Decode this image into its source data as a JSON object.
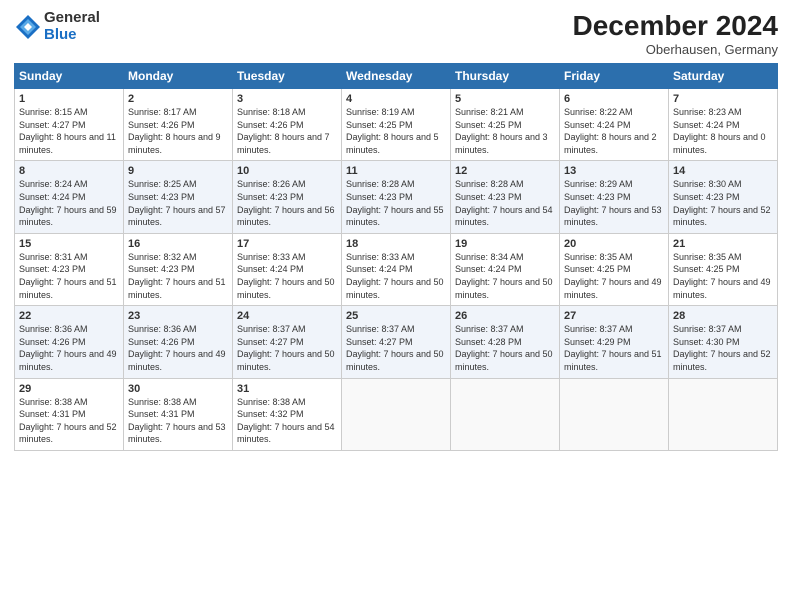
{
  "logo": {
    "general": "General",
    "blue": "Blue"
  },
  "title": "December 2024",
  "subtitle": "Oberhausen, Germany",
  "weekdays": [
    "Sunday",
    "Monday",
    "Tuesday",
    "Wednesday",
    "Thursday",
    "Friday",
    "Saturday"
  ],
  "weeks": [
    [
      {
        "day": "1",
        "sunrise": "8:15 AM",
        "sunset": "4:27 PM",
        "daylight": "8 hours and 11 minutes."
      },
      {
        "day": "2",
        "sunrise": "8:17 AM",
        "sunset": "4:26 PM",
        "daylight": "8 hours and 9 minutes."
      },
      {
        "day": "3",
        "sunrise": "8:18 AM",
        "sunset": "4:26 PM",
        "daylight": "8 hours and 7 minutes."
      },
      {
        "day": "4",
        "sunrise": "8:19 AM",
        "sunset": "4:25 PM",
        "daylight": "8 hours and 5 minutes."
      },
      {
        "day": "5",
        "sunrise": "8:21 AM",
        "sunset": "4:25 PM",
        "daylight": "8 hours and 3 minutes."
      },
      {
        "day": "6",
        "sunrise": "8:22 AM",
        "sunset": "4:24 PM",
        "daylight": "8 hours and 2 minutes."
      },
      {
        "day": "7",
        "sunrise": "8:23 AM",
        "sunset": "4:24 PM",
        "daylight": "8 hours and 0 minutes."
      }
    ],
    [
      {
        "day": "8",
        "sunrise": "8:24 AM",
        "sunset": "4:24 PM",
        "daylight": "7 hours and 59 minutes."
      },
      {
        "day": "9",
        "sunrise": "8:25 AM",
        "sunset": "4:23 PM",
        "daylight": "7 hours and 57 minutes."
      },
      {
        "day": "10",
        "sunrise": "8:26 AM",
        "sunset": "4:23 PM",
        "daylight": "7 hours and 56 minutes."
      },
      {
        "day": "11",
        "sunrise": "8:28 AM",
        "sunset": "4:23 PM",
        "daylight": "7 hours and 55 minutes."
      },
      {
        "day": "12",
        "sunrise": "8:28 AM",
        "sunset": "4:23 PM",
        "daylight": "7 hours and 54 minutes."
      },
      {
        "day": "13",
        "sunrise": "8:29 AM",
        "sunset": "4:23 PM",
        "daylight": "7 hours and 53 minutes."
      },
      {
        "day": "14",
        "sunrise": "8:30 AM",
        "sunset": "4:23 PM",
        "daylight": "7 hours and 52 minutes."
      }
    ],
    [
      {
        "day": "15",
        "sunrise": "8:31 AM",
        "sunset": "4:23 PM",
        "daylight": "7 hours and 51 minutes."
      },
      {
        "day": "16",
        "sunrise": "8:32 AM",
        "sunset": "4:23 PM",
        "daylight": "7 hours and 51 minutes."
      },
      {
        "day": "17",
        "sunrise": "8:33 AM",
        "sunset": "4:24 PM",
        "daylight": "7 hours and 50 minutes."
      },
      {
        "day": "18",
        "sunrise": "8:33 AM",
        "sunset": "4:24 PM",
        "daylight": "7 hours and 50 minutes."
      },
      {
        "day": "19",
        "sunrise": "8:34 AM",
        "sunset": "4:24 PM",
        "daylight": "7 hours and 50 minutes."
      },
      {
        "day": "20",
        "sunrise": "8:35 AM",
        "sunset": "4:25 PM",
        "daylight": "7 hours and 49 minutes."
      },
      {
        "day": "21",
        "sunrise": "8:35 AM",
        "sunset": "4:25 PM",
        "daylight": "7 hours and 49 minutes."
      }
    ],
    [
      {
        "day": "22",
        "sunrise": "8:36 AM",
        "sunset": "4:26 PM",
        "daylight": "7 hours and 49 minutes."
      },
      {
        "day": "23",
        "sunrise": "8:36 AM",
        "sunset": "4:26 PM",
        "daylight": "7 hours and 49 minutes."
      },
      {
        "day": "24",
        "sunrise": "8:37 AM",
        "sunset": "4:27 PM",
        "daylight": "7 hours and 50 minutes."
      },
      {
        "day": "25",
        "sunrise": "8:37 AM",
        "sunset": "4:27 PM",
        "daylight": "7 hours and 50 minutes."
      },
      {
        "day": "26",
        "sunrise": "8:37 AM",
        "sunset": "4:28 PM",
        "daylight": "7 hours and 50 minutes."
      },
      {
        "day": "27",
        "sunrise": "8:37 AM",
        "sunset": "4:29 PM",
        "daylight": "7 hours and 51 minutes."
      },
      {
        "day": "28",
        "sunrise": "8:37 AM",
        "sunset": "4:30 PM",
        "daylight": "7 hours and 52 minutes."
      }
    ],
    [
      {
        "day": "29",
        "sunrise": "8:38 AM",
        "sunset": "4:31 PM",
        "daylight": "7 hours and 52 minutes."
      },
      {
        "day": "30",
        "sunrise": "8:38 AM",
        "sunset": "4:31 PM",
        "daylight": "7 hours and 53 minutes."
      },
      {
        "day": "31",
        "sunrise": "8:38 AM",
        "sunset": "4:32 PM",
        "daylight": "7 hours and 54 minutes."
      },
      null,
      null,
      null,
      null
    ]
  ]
}
